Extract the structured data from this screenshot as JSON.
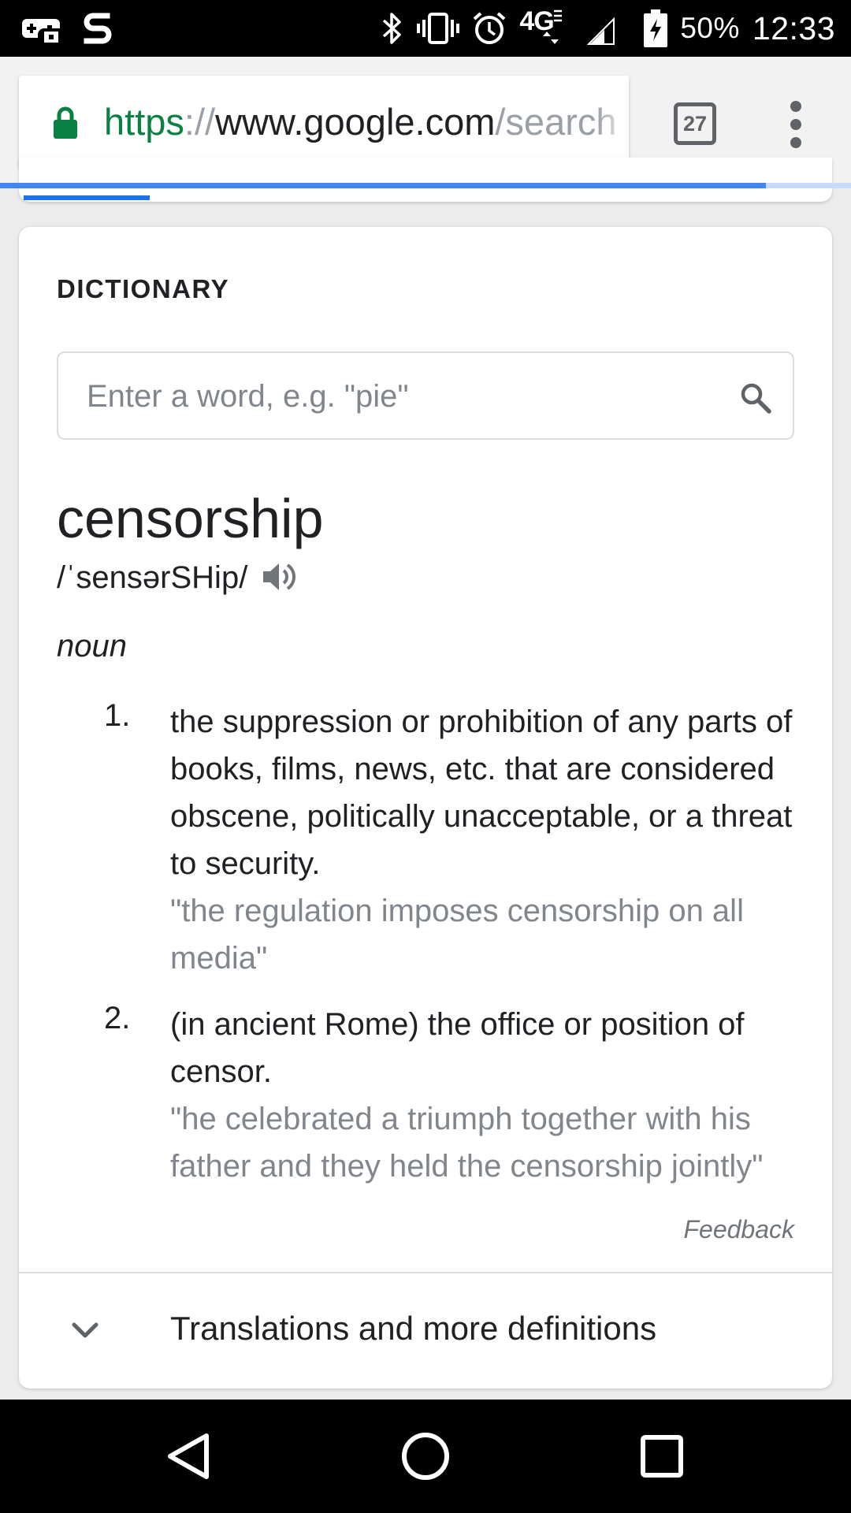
{
  "status_bar": {
    "icons_left": [
      "game-controller-icon",
      "s-app-icon"
    ],
    "icons_right": [
      "bluetooth-icon",
      "vibrate-icon",
      "alarm-icon",
      "network-4g-lte-icon",
      "signal-icon",
      "battery-charging-icon"
    ],
    "network_label": "4G",
    "battery": "50%",
    "time": "12:33"
  },
  "browser": {
    "url_scheme": "https",
    "url_separator": "://",
    "url_host": "www.google.com",
    "url_path": "/search",
    "tab_count": "27",
    "load_progress": 0.9,
    "colors": {
      "secure": "#0b8043",
      "progress": "#4285f4"
    }
  },
  "dictionary": {
    "title": "DICTIONARY",
    "search_placeholder": "Enter a word, e.g. \"pie\"",
    "search_value": "",
    "word": "censorship",
    "phonetic": "/ˈsensərSHip/",
    "part_of_speech": "noun",
    "senses": [
      {
        "number": "1.",
        "definition": "the suppression or prohibition of any parts of books, films, news, etc. that are considered obscene, politically unacceptable, or a threat to security.",
        "example": "\"the regulation imposes censorship on all media\""
      },
      {
        "number": "2.",
        "definition": "(in ancient Rome) the office or position of censor.",
        "example": "\"he celebrated a triumph together with his father and they held the censorship jointly\""
      }
    ],
    "feedback": "Feedback",
    "more_label": "Translations and more definitions"
  },
  "nav_bar": {
    "buttons": [
      "back-icon",
      "home-icon",
      "recents-icon"
    ]
  }
}
